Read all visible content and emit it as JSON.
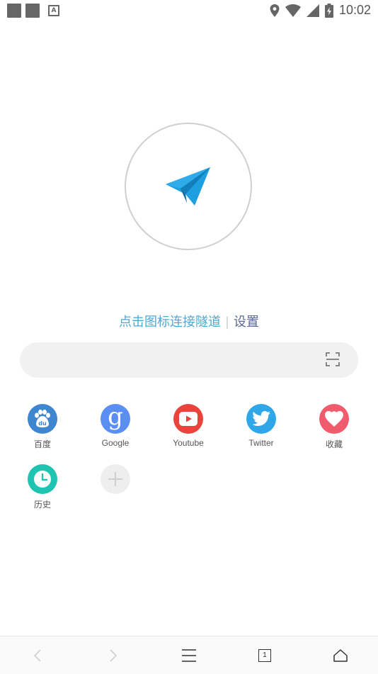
{
  "status_bar": {
    "time": "10:02",
    "icons": [
      "app-square-icon",
      "app-square-icon",
      "a-font-icon",
      "location-icon",
      "wifi-icon",
      "signal-icon",
      "battery-charging-icon"
    ]
  },
  "logo": {
    "icon": "paper-plane-icon",
    "color": "#1e9fe0"
  },
  "prompt": {
    "connect_text": "点击图标连接隧道",
    "separator": "|",
    "settings_text": "设置"
  },
  "search": {
    "value": "",
    "placeholder": "",
    "scan_icon": "scan-icon"
  },
  "shortcuts": [
    {
      "label": "百度",
      "icon": "baidu-icon",
      "color": "#3f86d0"
    },
    {
      "label": "Google",
      "icon": "google-icon",
      "color": "#5b8ef2"
    },
    {
      "label": "Youtube",
      "icon": "youtube-icon",
      "color": "#e8443b"
    },
    {
      "label": "Twitter",
      "icon": "twitter-icon",
      "color": "#2fa6e8"
    },
    {
      "label": "收藏",
      "icon": "heart-icon",
      "color": "#f05b6e"
    },
    {
      "label": "历史",
      "icon": "clock-icon",
      "color": "#1ec3b2"
    },
    {
      "label": "",
      "icon": "add-icon",
      "color": "#eeeeee"
    }
  ],
  "bottom_nav": {
    "tab_count": "1",
    "items": [
      "back-icon",
      "forward-icon",
      "menu-icon",
      "tabs-icon",
      "home-icon"
    ]
  }
}
